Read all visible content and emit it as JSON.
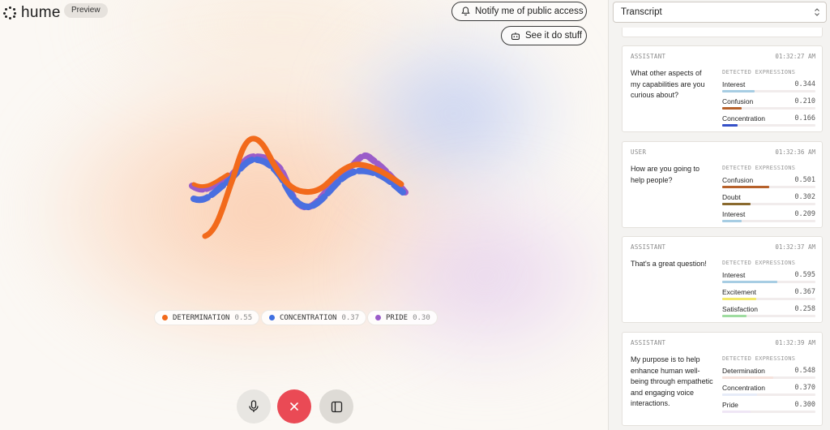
{
  "header": {
    "logo_text": "hume",
    "badge": "Preview",
    "notify_label": "Notify me of public access",
    "see_label": "See it do stuff"
  },
  "legend": [
    {
      "name": "DETERMINATION",
      "value": "0.55",
      "color": "#f26a1b"
    },
    {
      "name": "CONCENTRATION",
      "value": "0.37",
      "color": "#3f6fe0"
    },
    {
      "name": "PRIDE",
      "value": "0.30",
      "color": "#9a5cc9"
    }
  ],
  "controls": {
    "mic": "microphone-icon",
    "end": "close-icon",
    "panel": "sidebar-toggle-icon"
  },
  "transcript": {
    "select_value": "Transcript",
    "expressions_header": "DETECTED EXPRESSIONS",
    "messages": [
      {
        "role": "ASSISTANT",
        "time": "01:32:27 AM",
        "text": "What other aspects of my capabilities are you curious about?",
        "expressions": [
          {
            "name": "Interest",
            "score": "0.344",
            "level": 0.344,
            "color": "#a7cde3"
          },
          {
            "name": "Confusion",
            "score": "0.210",
            "level": 0.21,
            "color": "#b6612b"
          },
          {
            "name": "Concentration",
            "score": "0.166",
            "level": 0.166,
            "color": "#3550c8"
          }
        ]
      },
      {
        "role": "USER",
        "time": "01:32:36 AM",
        "text": "How are you going to help people?",
        "expressions": [
          {
            "name": "Confusion",
            "score": "0.501",
            "level": 0.501,
            "color": "#b6612b"
          },
          {
            "name": "Doubt",
            "score": "0.302",
            "level": 0.302,
            "color": "#8a6a2e"
          },
          {
            "name": "Interest",
            "score": "0.209",
            "level": 0.209,
            "color": "#a7cde3"
          }
        ]
      },
      {
        "role": "ASSISTANT",
        "time": "01:32:37 AM",
        "text": "That's a great question!",
        "expressions": [
          {
            "name": "Interest",
            "score": "0.595",
            "level": 0.595,
            "color": "#a7cde3"
          },
          {
            "name": "Excitement",
            "score": "0.367",
            "level": 0.367,
            "color": "#f3e96a"
          },
          {
            "name": "Satisfaction",
            "score": "0.258",
            "level": 0.258,
            "color": "#9fdca0"
          }
        ]
      },
      {
        "role": "ASSISTANT",
        "time": "01:32:39 AM",
        "text": "My purpose is to help enhance human well-being through empathetic and engaging voice interactions.",
        "expressions": [
          {
            "name": "Determination",
            "score": "0.548",
            "level": 0.548,
            "color": "#f5e2dc"
          },
          {
            "name": "Concentration",
            "score": "0.370",
            "level": 0.37,
            "color": "#e6ebf8"
          },
          {
            "name": "Pride",
            "score": "0.300",
            "level": 0.3,
            "color": "#efe6f5"
          }
        ]
      }
    ]
  }
}
